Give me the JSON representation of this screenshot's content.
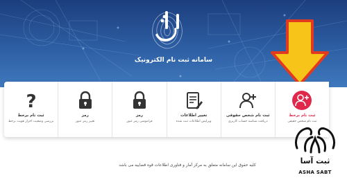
{
  "hero": {
    "title": "سامانه ثبت نام الکترونیک",
    "logo_icon": "thabt-calligraphy-fingerprint-logo",
    "background_color": "#2d5ea3"
  },
  "annotation": {
    "arrow_icon": "yellow-down-arrow",
    "arrow_color": "#f7c51a",
    "arrow_outline": "#e23a1e"
  },
  "cards": [
    {
      "title": "ثبت نام برخط",
      "subtitle": "ثبت نام شخص حقیقی",
      "icon": "add-user-icon",
      "active": true
    },
    {
      "title": "ثبت نام شخص حقوقی",
      "subtitle": "دریافت شناسه حساب کاربری",
      "icon": "add-user-icon",
      "active": false
    },
    {
      "title": "تغییر اطلاعات",
      "subtitle": "ویرایش اطلاعات ثبت شده",
      "icon": "edit-document-icon",
      "active": false
    },
    {
      "title": "رمز",
      "subtitle": "فراموشی رمز عبور",
      "icon": "lock-icon",
      "active": false
    },
    {
      "title": "رمز",
      "subtitle": "تغییر رمز عبور",
      "icon": "lock-icon",
      "active": false
    },
    {
      "title": "ثبت نام برخط",
      "subtitle": "بررسی وضعیت احراز هویت برخط",
      "icon": "help-question-icon",
      "active": false
    }
  ],
  "footer": {
    "copyright": "کلیه حقوق این سامانه متعلق به مرکز آمار و فناوری اطلاعات قوه قضاییه می باشد"
  },
  "brand": {
    "name_fa": "ثبت آسا",
    "name_en": "ASHA SABT",
    "icon": "asha-sabt-ribbon-logo"
  },
  "colors": {
    "accent": "#e0284b",
    "icon": "#333333"
  }
}
